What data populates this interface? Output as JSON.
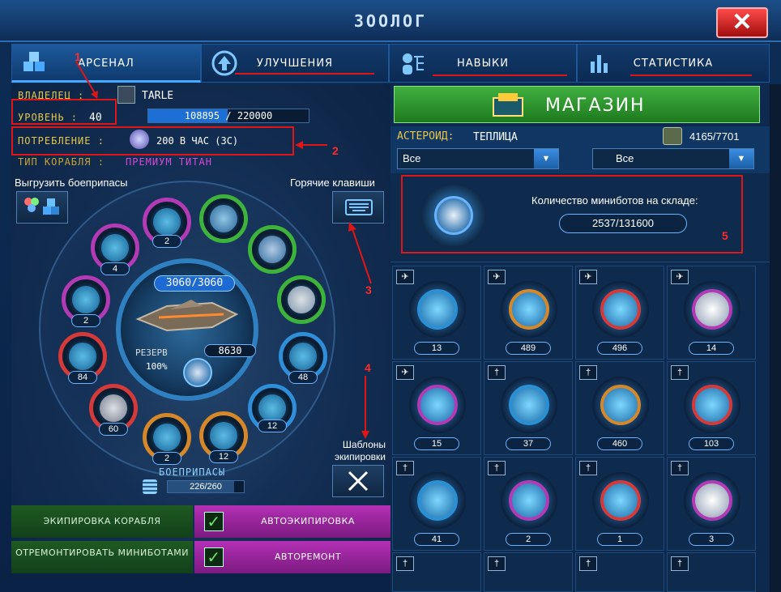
{
  "window": {
    "title": "ЗООЛОГ",
    "close_icon": "close-x-icon"
  },
  "tabs": [
    {
      "label": "АРСЕНАЛ",
      "icon": "boxes-icon",
      "active": true
    },
    {
      "label": "УЛУЧШЕНИЯ",
      "icon": "upgrade-arrow-icon"
    },
    {
      "label": "НАВЫКИ",
      "icon": "skills-tree-icon"
    },
    {
      "label": "СТАТИСТИКА",
      "icon": "bar-chart-icon"
    }
  ],
  "ship": {
    "owner_label": "ВЛАДЕЛЕЦ :",
    "owner_name": "TARLE",
    "level_label": "УРОВЕНЬ :",
    "level_value": "40",
    "xp_current": "108895",
    "xp_sep": "/",
    "xp_total": "220000",
    "xp_progress": 0.495,
    "consumption_label": "ПОТРЕБЛЕНИЕ :",
    "consumption_value": "200 В ЧАС (3C)",
    "type_label": "ТИП КОРАБЛЯ :",
    "type_value": "ПРЕМИУМ ТИТАН",
    "hp": "3060/3060",
    "reserve_label": "РЕЗЕРВ",
    "reserve_value": "8630",
    "reserve_pct": "100%"
  },
  "unload_label": "Выгрузить боеприпасы",
  "hotkeys_label": "Горячие клавиши",
  "templates_label": "Шаблоны экипировки",
  "ammo": {
    "label": "БОЕПРИПАСЫ",
    "value": "226/260",
    "fill": 0.869
  },
  "slots": [
    {
      "count": "2"
    },
    {
      "count": ""
    },
    {
      "count": ""
    },
    {
      "count": "4"
    },
    {
      "count": ""
    },
    {
      "count": "2"
    },
    {
      "count": "84"
    },
    {
      "count": "48"
    },
    {
      "count": "60"
    },
    {
      "count": "12"
    },
    {
      "count": "2"
    },
    {
      "count": "12"
    }
  ],
  "annotations": [
    "1",
    "2",
    "3",
    "4",
    "5"
  ],
  "bottom_buttons": {
    "equip_ship": "ЭКИПИРОВКА КОРАБЛЯ",
    "auto_equip": "АВТОЭКИПИРОВКА",
    "repair": "ОТРЕМОНТИРОВАТЬ МИНИБОТАМИ",
    "auto_repair": "АВТОРЕМОНТ"
  },
  "shop": {
    "label": "МАГАЗИН"
  },
  "asteroid": {
    "label": "АСТЕРОИД:",
    "name": "ТЕПЛИЦА",
    "capacity": "4165/7701"
  },
  "filters": [
    {
      "value": "Все"
    },
    {
      "value": "Все"
    }
  ],
  "minibots": {
    "label": "Количество миниботов на складе:",
    "value": "2537/131600"
  },
  "items": [
    {
      "count": "13",
      "badge": "rocket"
    },
    {
      "count": "489",
      "badge": "rocket"
    },
    {
      "count": "496",
      "badge": "rocket"
    },
    {
      "count": "14",
      "badge": "rocket"
    },
    {
      "count": "15",
      "badge": "rocket"
    },
    {
      "count": "37",
      "badge": "sword"
    },
    {
      "count": "460",
      "badge": "sword"
    },
    {
      "count": "103",
      "badge": "sword"
    },
    {
      "count": "41",
      "badge": "sword"
    },
    {
      "count": "2",
      "badge": "sword"
    },
    {
      "count": "1",
      "badge": "sword"
    },
    {
      "count": "3",
      "badge": "sword"
    }
  ],
  "colors": {
    "accent": "#4aa8ff",
    "shop_green": "#2f9a2f",
    "annotation_red": "#e01515",
    "magenta": "#c233c4"
  }
}
